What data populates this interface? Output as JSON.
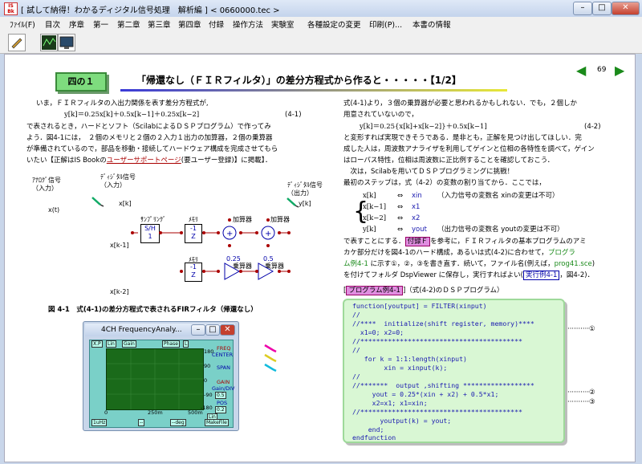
{
  "window": {
    "title": "[ 試して納得！わかるディジタル信号処理　解析編 ] < 0660000.tec >",
    "icon_text": "IS\nBooks"
  },
  "menu": [
    "ﾌｧｲﾙ(F)",
    "目次",
    "序章",
    "第一",
    "第二章",
    "第三章",
    "第四章",
    "付録",
    "操作方法",
    "実験室",
    "各種設定の変更",
    "印刷(P)...",
    "本書の情報"
  ],
  "page": {
    "section": "四の１",
    "title": "「帰還なし（ＦＩＲフィルタ）」の差分方程式から作ると・・・・・【1/2】",
    "page_number": "69"
  },
  "left": {
    "p1": "いま，ＦＩＲフィルタの入出力関係を表す差分方程式が,",
    "eq1": "y[k]＝0.25x[k]＋0.5x[k−1]＋0.25x[k−2]",
    "eq1_no": "(4-1)",
    "p2": "で表されるとき，ハードとソフト（ScilabによるＤＳＰプログラム）で作ってみ",
    "p3": "よう．図4-1には，　２個のメモリと２個の２入力１出力の加算器，２個の乗算器",
    "p4": "が準備されているので，部品を移動・接続してハードウェア構成を完成させてもら",
    "p5_a": "いたい【正解はIS Bookの",
    "p5_link": "ユーザーサポートページ",
    "p5_b": "(要ユーザー登録)】に掲載】．",
    "fig_caption": "図 4-1　式(4-1)の差分方程式で表されるFIRフィルタ（帰還なし）"
  },
  "diagram": {
    "analog_in": "ｱﾅﾛｸﾞ信号\n（入力）",
    "digital_in": "ﾃﾞｨｼﾞﾀﾙ信号\n（入力）",
    "digital_out": "ﾃﾞｨｼﾞﾀﾙ信号\n（出力）",
    "xt": "x(t)",
    "xk": "x[k]",
    "xk1": "x[k-1]",
    "xk2": "x[k-2]",
    "yk": "y[k]",
    "sampling": "ｻﾝﾌﾟﾘﾝｸﾞ",
    "sh": "S/H\n1",
    "memory": "ﾒﾓﾘ",
    "z": "-1\nZ",
    "adder": "加算器",
    "mult": "乗算器",
    "g1": "0.25",
    "g2": "0.5"
  },
  "analyzer": {
    "title": "4CH FrequencyAnaly...",
    "tabs": [
      "X.P",
      "Lin",
      "Gain",
      "Phase",
      "L"
    ],
    "right_labels": [
      "FREQ",
      "CENTER",
      "SPAN",
      "GAIN",
      "Gain/DIV",
      "POS"
    ],
    "right_values": [
      "0.5",
      "0.2",
      "Lin"
    ],
    "y_ticks": [
      "180",
      "90",
      "0",
      "-90",
      "-180"
    ],
    "x_ticks": [
      "0",
      "250m",
      "500m"
    ],
    "bottom": [
      "1uHz",
      "--",
      "--deg",
      "MakeFile"
    ]
  },
  "right": {
    "r1": "式(4-1)より，３個の乗算器が必要と思われるかもしれない．でも，２個しか",
    "r2": "用意されていないので，",
    "eq2": "y[k]＝0.25{x[k]+x[k−2]}＋0.5x[k−1]",
    "eq2_no": "(4-2)",
    "r3": "と変形すれば実現できそうである．是非とも，正解を見つけ出してほしい．完",
    "r4": "成した人は，周波数アナライザを利用してゲインと位相の各特性を調べて，ゲイン",
    "r5": "はローパス特性，位相は周波数に正比例することを確認しておこう．",
    "r6": "　次は，Scilabを用いてＤＳＰプログラミングに挑戦！",
    "r7": "最初のステップは，式（4-2）の変数の割り当てから．ここでは，",
    "vars": [
      {
        "k": "x[k]",
        "v": "xin",
        "note": "（入力信号の変数名 xinの変更は不可）"
      },
      {
        "k": "x[k−1]",
        "v": "x1",
        "note": ""
      },
      {
        "k": "x[k−2]",
        "v": "x2",
        "note": ""
      },
      {
        "k": "y[k]",
        "v": "yout",
        "note": "（出力信号の変数名 youtの変更は不可）"
      }
    ],
    "arrow": "⇔",
    "r8_a": "で表すことにする．",
    "r8_tag": "付録Ｆ",
    "r8_b": "を参考に，ＦＩＲフィルタの基本プログラムのアミ",
    "r9_a": "カケ部分だけを図4-1のハード構成，あるいは式(4-2)に合わせて，",
    "r9_link": "プログラ",
    "r10_a": "ム例4-1",
    "r10_b": " に示す①，②，③を書き直す．続いて，ファイル名(例えば，",
    "r10_file": "prog41.sce",
    "r10_c": ")",
    "r11_a": "を付けてフォルダ DspViewer に保存し，実行すればよい(",
    "r11_tag": "実行例4-1",
    "r11_b": "，図4-2)．",
    "prog_label": "プログラム例4-1",
    "prog_caption": "（式(4-2)のＤＳＰプログラム）",
    "code": [
      "function[youtput] = FILTER(xinput)",
      "//",
      "//****  initialize(shift register, memory)****",
      "  x1=0; x2=0;",
      "//*****************************************",
      "//",
      "   for k = 1:1:length(xinput)",
      "        xin = xinput(k);",
      "//",
      "//*******  output ,shifting ******************",
      "     yout = 0.25*(xin + x2) + 0.5*x1;",
      "     x2=x1; x1=xin;",
      "//*****************************************",
      "       youtput(k) = yout;",
      "    end;",
      "endfunction"
    ],
    "markers": [
      "①",
      "②",
      "③"
    ]
  }
}
